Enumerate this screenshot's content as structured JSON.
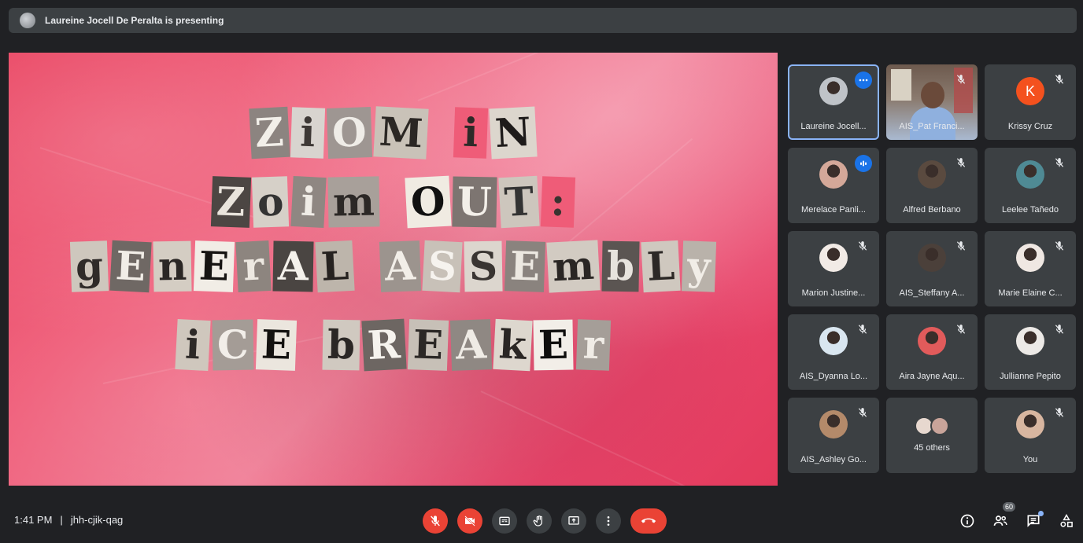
{
  "banner": {
    "text": "Laureine Jocell De Peralta is presenting"
  },
  "slide": {
    "lines": [
      [
        {
          "t": "Z",
          "bg": "#8c8480",
          "fg": "#f2efe9"
        },
        {
          "t": "i",
          "bg": "#d8d4cf",
          "fg": "#3e3936"
        },
        {
          "t": "O",
          "bg": "#9e9692",
          "fg": "#efece7"
        },
        {
          "t": "M",
          "bg": "#c9c2b8",
          "fg": "#2b2724"
        },
        {
          "gap": true
        },
        {
          "t": "i",
          "bg": "#ef5c78",
          "fg": "#2e2a28"
        },
        {
          "t": "N",
          "bg": "#dcd6cd",
          "fg": "#1e1b1a"
        }
      ],
      [
        {
          "t": "Z",
          "bg": "#4c4643",
          "fg": "#e9e4dc"
        },
        {
          "t": "o",
          "bg": "#d6d0c8",
          "fg": "#333"
        },
        {
          "t": "i",
          "bg": "#8f8782",
          "fg": "#f0ece6"
        },
        {
          "t": "m",
          "bg": "#a8a09a",
          "fg": "#2c2826"
        },
        {
          "gap": true
        },
        {
          "t": "O",
          "bg": "#f0ebe2",
          "fg": "#111"
        },
        {
          "t": "U",
          "bg": "#7d7571",
          "fg": "#f3efe9"
        },
        {
          "t": "T",
          "bg": "#cdc6bd",
          "fg": "#333"
        },
        {
          "t": ":",
          "bg": "#ef5c78",
          "fg": "#3a3330"
        }
      ],
      [
        {
          "t": "g",
          "bg": "#cec7bd",
          "fg": "#2f2b29"
        },
        {
          "t": "E",
          "bg": "#6f6864",
          "fg": "#f1ede7"
        },
        {
          "t": "n",
          "bg": "#d4cdc3",
          "fg": "#2b2725"
        },
        {
          "t": "E",
          "bg": "#f1ede6",
          "fg": "#161412"
        },
        {
          "t": "r",
          "bg": "#8d857f",
          "fg": "#ede8e1"
        },
        {
          "t": "A",
          "bg": "#4a4542",
          "fg": "#f4f1eb"
        },
        {
          "t": "L",
          "bg": "#bdb5ab",
          "fg": "#262220"
        },
        {
          "gap": true
        },
        {
          "t": "A",
          "bg": "#9c948e",
          "fg": "#f2eee8"
        },
        {
          "t": "S",
          "bg": "#c8c1b8",
          "fg": "#f6f3ee"
        },
        {
          "t": "S",
          "bg": "#dcd6ce",
          "fg": "#3a3532"
        },
        {
          "t": "E",
          "bg": "#8a837e",
          "fg": "#ece8e1"
        },
        {
          "t": "m",
          "bg": "#d2cbc2",
          "fg": "#2a2624"
        },
        {
          "t": "b",
          "bg": "#5b5552",
          "fg": "#e7e3dd"
        },
        {
          "t": "L",
          "bg": "#cfc8bf",
          "fg": "#2c2826"
        },
        {
          "t": "y",
          "bg": "#b9b2aa",
          "fg": "#f1ede7"
        }
      ],
      [
        {
          "t": "i",
          "bg": "#cfc7bd",
          "fg": "#2d2927"
        },
        {
          "t": "C",
          "bg": "#a49c96",
          "fg": "#f2eee9"
        },
        {
          "t": "E",
          "bg": "#ebe6de",
          "fg": "#141210"
        },
        {
          "gap": true
        },
        {
          "t": "b",
          "bg": "#d0c9c0",
          "fg": "#2b2725"
        },
        {
          "t": "R",
          "bg": "#6d6662",
          "fg": "#f6f3ee"
        },
        {
          "t": "E",
          "bg": "#c7c0b7",
          "fg": "#2c2826"
        },
        {
          "t": "A",
          "bg": "#8f8883",
          "fg": "#efebe5"
        },
        {
          "t": "k",
          "bg": "#ddd7ce",
          "fg": "#2a2624"
        },
        {
          "t": "E",
          "bg": "#f2eee8",
          "fg": "#0f0e0d"
        },
        {
          "t": "r",
          "bg": "#a59e98",
          "fg": "#f0ece6"
        }
      ]
    ]
  },
  "participants": [
    {
      "name": "Laureine Jocell...",
      "kind": "avatar",
      "color": "#bfc3c8",
      "active": true,
      "badge": "more"
    },
    {
      "name": "AIS_Pat Franci...",
      "kind": "video",
      "muted": true
    },
    {
      "name": "Krissy Cruz",
      "kind": "letter",
      "letter": "K",
      "muted": true
    },
    {
      "name": "Merelace Panli...",
      "kind": "avatar",
      "color": "#d4a899",
      "badge": "speaking"
    },
    {
      "name": "Alfred Berbano",
      "kind": "avatar",
      "color": "#5a4a3f",
      "muted": true
    },
    {
      "name": "Leelee Tañedo",
      "kind": "avatar",
      "color": "#4f8a94",
      "muted": true
    },
    {
      "name": "Marion Justine...",
      "kind": "avatar",
      "color": "#f2ebe6",
      "muted": true
    },
    {
      "name": "AIS_Steffany A...",
      "kind": "avatar",
      "color": "#4b403a",
      "muted": true
    },
    {
      "name": "Marie Elaine C...",
      "kind": "avatar",
      "color": "#efe7e2",
      "muted": true
    },
    {
      "name": "AIS_Dyanna Lo...",
      "kind": "avatar",
      "color": "#d9e6f0",
      "muted": true
    },
    {
      "name": "Aira Jayne Aqu...",
      "kind": "avatar",
      "color": "#e25b5b",
      "muted": true
    },
    {
      "name": "Jullianne Pepito",
      "kind": "avatar",
      "color": "#ece9e6",
      "muted": true
    },
    {
      "name": "AIS_Ashley Go...",
      "kind": "avatar",
      "color": "#b48a6a",
      "muted": true
    },
    {
      "name": "45 others",
      "kind": "others"
    },
    {
      "name": "You",
      "kind": "avatar",
      "color": "#d8b6a0",
      "muted": true
    }
  ],
  "footer": {
    "time": "1:41 PM",
    "separator": "|",
    "meeting_code": "jhh-cjik-qag",
    "people_count": "60"
  }
}
